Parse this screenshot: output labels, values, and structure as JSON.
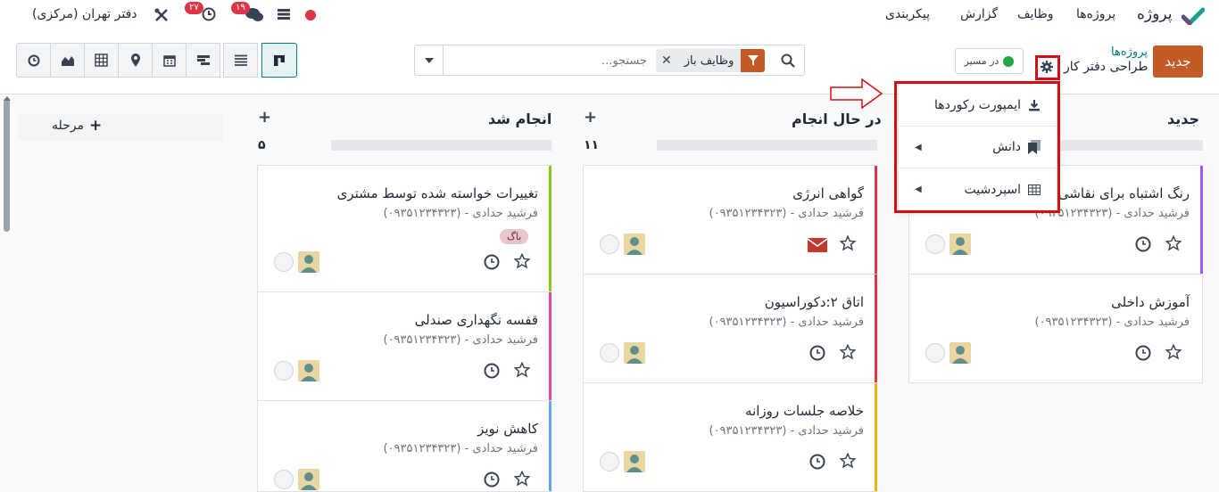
{
  "topbar": {
    "brand": "پروژه",
    "menu": [
      "پروژه‌ها",
      "وظایف",
      "گزارش",
      "پیکربندی"
    ],
    "company": "دفتر تهران (مرکزی)",
    "activity_badge": "۲۷",
    "messages_badge": "۱۹",
    "colors": {
      "accent": "#c25b25",
      "teal": "#017e84",
      "red": "#d40f14",
      "status_red": "#dc3545"
    }
  },
  "control": {
    "new_button": "جدید",
    "breadcrumb_parent": "پروژه‌ها",
    "breadcrumb_current": "طراحی دفتر کار",
    "status_label": "در مسیر",
    "search_placeholder": "جستجو...",
    "facet_label": "وظایف باز",
    "views": [
      "clock-icon",
      "area-chart-icon",
      "grid-icon",
      "map-marker-icon",
      "calendar-icon",
      "gantt-icon",
      "list-icon",
      "kanban-icon"
    ]
  },
  "dropdown": {
    "items": [
      {
        "label": "ایمپورت رکوردها",
        "icon": "download-icon"
      },
      {
        "label": "دانش",
        "icon": "bookmark-icon"
      },
      {
        "label": "اسپردشیت",
        "icon": "table-icon"
      }
    ]
  },
  "kanban": {
    "add_stage": "مرحله",
    "columns": [
      {
        "name": "جدید",
        "count": "",
        "cards": [
          {
            "title": "رنگ اشتباه برای نقاشی",
            "subtitle": "فرشید حدادی - (۰۹۳۵۱۲۳۴۳۲۳)",
            "stripe": "#a855f7"
          },
          {
            "title": "آموزش داخلی",
            "subtitle": "فرشید حدادی - (۰۹۳۵۱۲۳۴۳۲۳)",
            "stripe": ""
          }
        ]
      },
      {
        "name": "در حال انجام",
        "count": "۱۱",
        "cards": [
          {
            "title": "گواهی انرژی",
            "subtitle": "فرشید حدادی - (۰۹۳۵۱۲۳۴۳۲۳)",
            "stripe": "#dc3545"
          },
          {
            "title": "اتاق ۲:دکوراسیون",
            "subtitle": "فرشید حدادی - (۰۹۳۵۱۲۳۴۳۲۳)",
            "stripe": "#dc3545"
          },
          {
            "title": "خلاصه جلسات روزانه",
            "subtitle": "فرشید حدادی - (۰۹۳۵۱۲۳۴۳۲۳)",
            "stripe": "#eab308"
          }
        ]
      },
      {
        "name": "انجام شد",
        "count": "۵",
        "cards": [
          {
            "title": "تغییرات خواسته شده توسط مشتری",
            "subtitle": "فرشید حدادی - (۰۹۳۵۱۲۳۴۳۲۳)",
            "stripe": "#84cc16",
            "tag": "باگ"
          },
          {
            "title": "قفسه نگهداری صندلی",
            "subtitle": "فرشید حدادی - (۰۹۳۵۱۲۳۴۳۲۳)",
            "stripe": "#ec4899"
          },
          {
            "title": "کاهش نویز",
            "subtitle": "فرشید حدادی - (۰۹۳۵۱۲۳۴۳۲۳)",
            "stripe": "#60a5fa"
          }
        ]
      }
    ]
  }
}
